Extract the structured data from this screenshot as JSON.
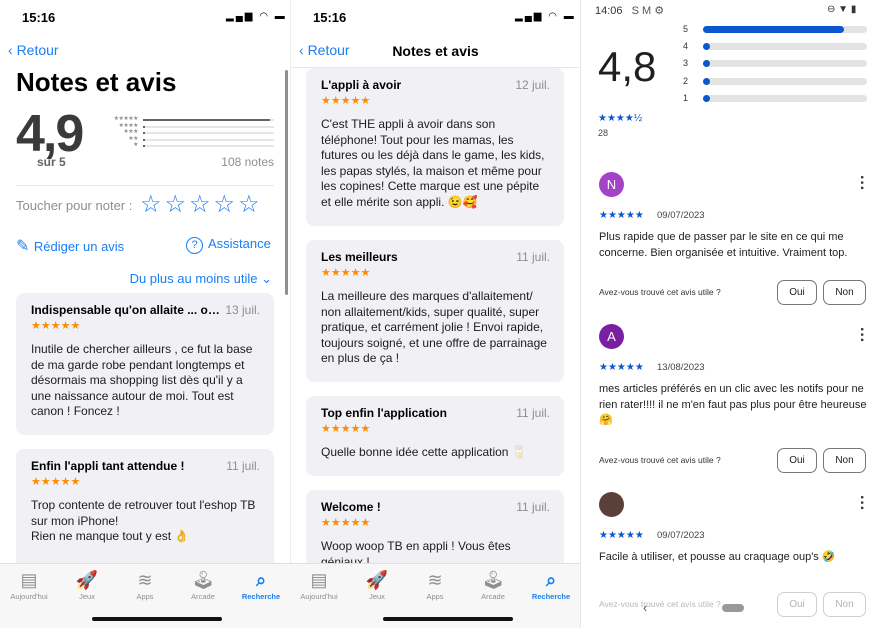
{
  "ios_left": {
    "status_time": "15:16",
    "back_label": "Retour",
    "title": "Notes et avis",
    "rating": "4,9",
    "rating_sub": "sur 5",
    "count_label": "108 notes",
    "distribution_fraction": {
      "5": 0.97,
      "4": 0.01,
      "3": 0.0,
      "2": 0.01,
      "1": 0.01
    },
    "tap_to_rate": "Toucher pour noter :",
    "write_review": "Rédiger un avis",
    "support": "Assistance",
    "sort_label": "Du plus au moins utile",
    "reviews": [
      {
        "title": "Indispensable qu'on allaite ... ou...",
        "date": "13 juil.",
        "stars": "★★★★★",
        "body": "Inutile de chercher ailleurs , ce fut la base de ma garde robe pendant longtemps et désormais ma shopping list dès qu'il y a une naissance autour de moi. Tout est canon ! Foncez !"
      },
      {
        "title": "Enfin l'appli tant attendue !",
        "date": "11 juil.",
        "stars": "★★★★★",
        "body": "Trop contente de retrouver tout l'eshop TB sur mon iPhone!\nRien ne manque tout y est 👌"
      }
    ]
  },
  "ios_mid": {
    "status_time": "15:16",
    "back_label": "Retour",
    "title": "Notes et avis",
    "reviews": [
      {
        "title": "L'appli à avoir",
        "date": "12 juil.",
        "stars": "★★★★★",
        "body": "C'est THE appli à avoir dans son téléphone! Tout pour les mamas, les futures ou les déjà dans le game, les kids, les papas stylés, la maison et même pour les copines! Cette marque est une pépite et elle mérite son appli. 😉🥰"
      },
      {
        "title": "Les meilleurs",
        "date": "11 juil.",
        "stars": "★★★★★",
        "body": "La meilleure des marques d'allaitement/ non allaitement/kids, super qualité, super pratique, et carrément jolie ! Envoi rapide, toujours soigné, et une offre de parrainage en plus de ça !"
      },
      {
        "title": "Top enfin l'application",
        "date": "11 juil.",
        "stars": "★★★★★",
        "body": "Quelle bonne idée cette application 🥛"
      },
      {
        "title": "Welcome !",
        "date": "11 juil.",
        "stars": "★★★★★",
        "body": "Woop woop TB en appli ! Vous êtes géniaux !"
      }
    ]
  },
  "tabbar": [
    {
      "label": "Aujourd'hui",
      "icon": "today-icon",
      "glyph": "▤"
    },
    {
      "label": "Jeux",
      "icon": "rocket-icon",
      "glyph": "🚀"
    },
    {
      "label": "Apps",
      "icon": "layers-icon",
      "glyph": "≋"
    },
    {
      "label": "Arcade",
      "icon": "joystick-icon",
      "glyph": "🕹"
    },
    {
      "label": "Recherche",
      "icon": "search-icon",
      "glyph": "⌕",
      "active": true
    }
  ],
  "android": {
    "status_time": "14:06",
    "status_icons": "S M ⚙",
    "status_right": "⊖ ▼ ▮",
    "rating": "4,8",
    "stars": "★★★★½",
    "count": "28",
    "distribution_fraction": {
      "5": 0.86,
      "4": 0.04,
      "3": 0.04,
      "2": 0.04,
      "1": 0.04
    },
    "distribution_labels": [
      "5",
      "4",
      "3",
      "2",
      "1"
    ],
    "helpful_question": "Avez-vous trouvé cet avis utile ?",
    "yes": "Oui",
    "no": "Non",
    "reviews": [
      {
        "initial": "N",
        "avatar_color": "#a442c8",
        "stars": "★★★★★",
        "date": "09/07/2023",
        "body": "Plus rapide que de passer par le site en ce qui me concerne. Bien organisée et intuitive. Vraiment top."
      },
      {
        "initial": "A",
        "avatar_color": "#7b1fa2",
        "stars": "★★★★★",
        "date": "13/08/2023",
        "body": "mes articles préférés en un clic avec les notifs pour ne rien rater!!!! il ne m'en faut pas plus pour être heureuse 🤗"
      },
      {
        "initial": "",
        "avatar_color": "#5a4038",
        "stars": "★★★★★",
        "date": "09/07/2023",
        "body": "Facile à utiliser, et pousse au craquage oup's 🤣"
      }
    ]
  },
  "colors": {
    "ios_accent": "#1a7ef5",
    "ios_star": "#ff8a00",
    "android_accent": "#0b57d0"
  }
}
